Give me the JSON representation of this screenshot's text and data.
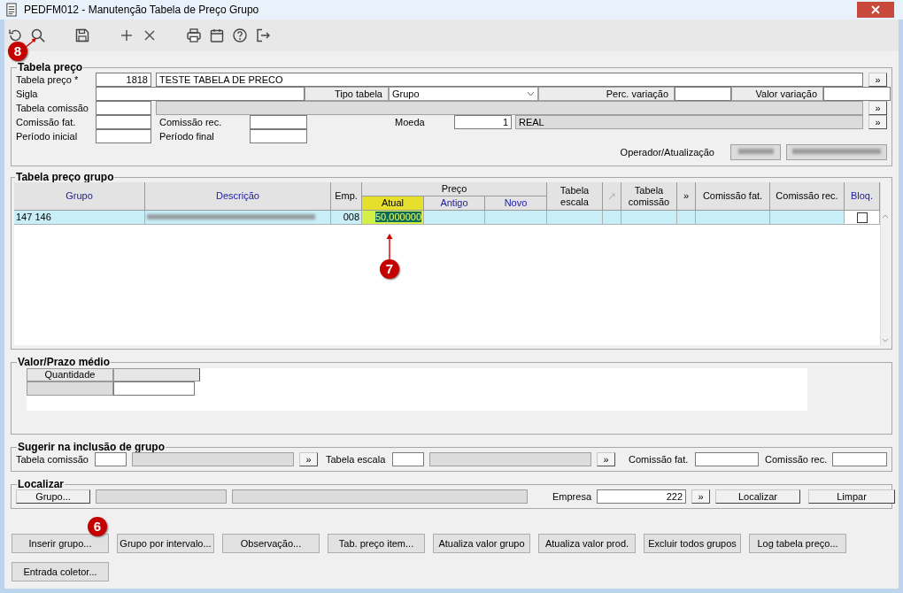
{
  "window": {
    "title": "PEDFM012 - Manutenção Tabela de Preço Grupo"
  },
  "toolbar": {
    "groups": [
      {
        "items": [
          {
            "kind": "undo"
          },
          {
            "kind": "search"
          }
        ]
      },
      {
        "items": [
          {
            "kind": "save"
          }
        ]
      },
      {
        "items": [
          {
            "kind": "add"
          },
          {
            "kind": "delete"
          }
        ]
      },
      {
        "items": [
          {
            "kind": "print"
          },
          {
            "kind": "calendar"
          },
          {
            "kind": "help"
          },
          {
            "kind": "exit"
          }
        ]
      }
    ]
  },
  "tabela_preco": {
    "title": "Tabela preço",
    "tabela_preco": {
      "label": "Tabela preço *",
      "code": "1818",
      "name": "TESTE TABELA DE PRECO",
      "lookup": "»"
    },
    "sigla": {
      "label": "Sigla"
    },
    "tipo_tabela": {
      "label": "Tipo tabela",
      "value": "Grupo"
    },
    "perc_variacao": {
      "label": "Perc. variação"
    },
    "valor_variacao": {
      "label": "Valor variação"
    },
    "tabela_comissao": {
      "label": "Tabela comissão",
      "lookup": "»"
    },
    "comissao_fat": {
      "label": "Comissão fat."
    },
    "comissao_rec": {
      "label": "Comissão rec."
    },
    "moeda": {
      "label": "Moeda",
      "code": "1",
      "name": "REAL",
      "lookup": "»"
    },
    "periodo_inicial": {
      "label": "Período inicial"
    },
    "periodo_final": {
      "label": "Período final"
    },
    "operador": {
      "label": "Operador/Atualização"
    }
  },
  "grupos": {
    "title": "Tabela preço grupo",
    "columns": [
      {
        "label": "Grupo",
        "sortable": true
      },
      {
        "label": "Descrição",
        "sortable": true
      },
      {
        "label": "Emp.",
        "sortable": false
      },
      {
        "label": "Preço",
        "sortable": false,
        "children": [
          {
            "label": "Atual",
            "sortable": false,
            "selected": true
          },
          {
            "label": "Antigo",
            "sortable": true,
            "selected": false
          },
          {
            "label": "Novo",
            "sortable": true,
            "selected": false
          }
        ]
      },
      {
        "label": "Tabela escala",
        "sortable": false
      },
      {
        "kind": "icon"
      },
      {
        "label": "Tabela comissão",
        "sortable": false
      },
      {
        "label": "»",
        "sortable": false
      },
      {
        "label": "Comissão fat.",
        "sortable": false
      },
      {
        "label": "Comissão rec.",
        "sortable": false
      },
      {
        "label": "Bloq.",
        "sortable": true
      }
    ],
    "rows": [
      {
        "selected": true,
        "grupo": "147 146",
        "emp": "008",
        "atual": "50,000000",
        "atual_editing": true,
        "bloq": false
      }
    ]
  },
  "valor_prazo": {
    "title": "Valor/Prazo médio",
    "columns": [
      "Quantidade"
    ]
  },
  "sugerir": {
    "title": "Sugerir na inclusão de grupo",
    "tabela_comissao": {
      "label": "Tabela comissão",
      "lookup": "»"
    },
    "tabela_escala": {
      "label": "Tabela escala",
      "lookup": "»"
    },
    "comissao_fat": {
      "label": "Comissão fat."
    },
    "comissao_rec": {
      "label": "Comissão rec."
    }
  },
  "localizar": {
    "title": "Localizar",
    "grupo_button": "Grupo...",
    "empresa": {
      "label": "Empresa",
      "value": "222",
      "lookup": "»"
    },
    "buttons": [
      "Localizar",
      "Limpar"
    ]
  },
  "actions": [
    "Inserir grupo...",
    "Grupo por intervalo...",
    "Observação...",
    "Tab. preço item...",
    "Atualiza valor grupo",
    "Atualiza valor prod.",
    "Excluir todos grupos",
    "Log tabela preço...",
    "Entrada coletor..."
  ],
  "callouts": [
    {
      "number": "8"
    },
    {
      "number": "7"
    },
    {
      "number": "6"
    }
  ]
}
